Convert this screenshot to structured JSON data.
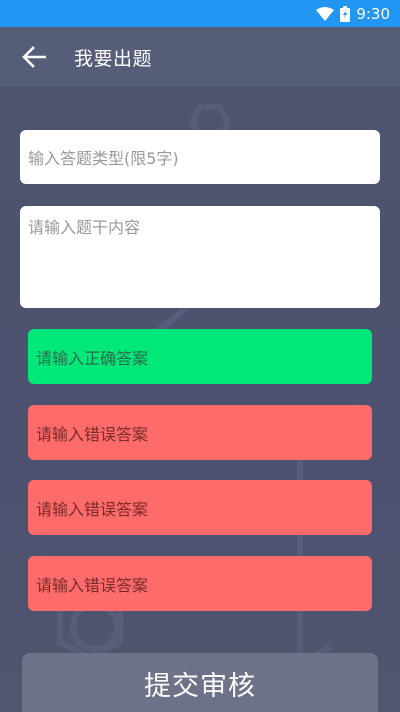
{
  "status_bar": {
    "time": "9:30"
  },
  "app_bar": {
    "title": "我要出题"
  },
  "form": {
    "type_placeholder": "输入答题类型(限5字)",
    "stem_placeholder": "请输入题干内容",
    "correct_answer_placeholder": "请输入正确答案",
    "wrong_answers": [
      {
        "placeholder": "请输入错误答案"
      },
      {
        "placeholder": "请输入错误答案"
      },
      {
        "placeholder": "请输入错误答案"
      }
    ],
    "submit_label": "提交审核"
  },
  "colors": {
    "status_bar": "#2196f3",
    "app_bar": "#565d78",
    "background": "#4f556f",
    "correct": "#00e77a",
    "wrong": "#fe6b6b",
    "submit": "#6d7289"
  }
}
